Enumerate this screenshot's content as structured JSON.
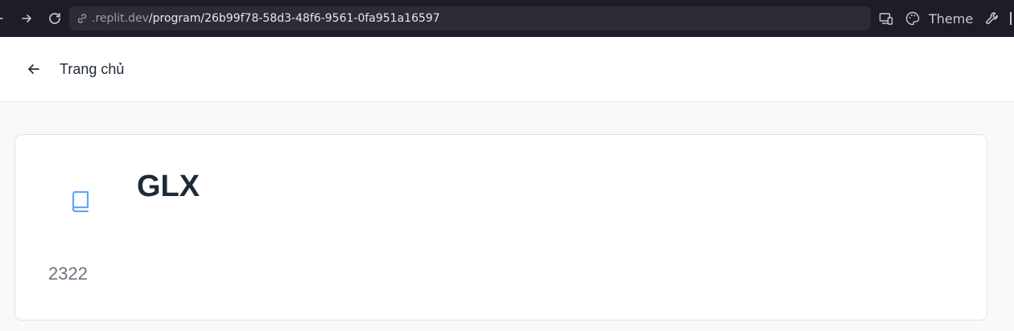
{
  "browser": {
    "url_host": ".replit.dev",
    "url_path": "/program/26b99f78-58d3-48f6-9561-0fa951a16597",
    "theme_label": "Theme",
    "icons": [
      "back-arrow-icon",
      "forward-arrow-icon",
      "reload-icon",
      "link-icon",
      "devices-icon",
      "palette-icon",
      "wrench-icon"
    ]
  },
  "header": {
    "back_icon": "arrow-left-icon",
    "title": "Trang chủ"
  },
  "program": {
    "icon": "book-icon",
    "title": "GLX",
    "number": "2322"
  },
  "colors": {
    "browser_bar": "#1c1d26",
    "omnibox": "#2b2c36",
    "page_background": "#f8f9fa",
    "card_background": "#ffffff",
    "accent_blue": "#60a5fa",
    "title_text": "#1f2937",
    "muted_text": "#6b7280"
  }
}
